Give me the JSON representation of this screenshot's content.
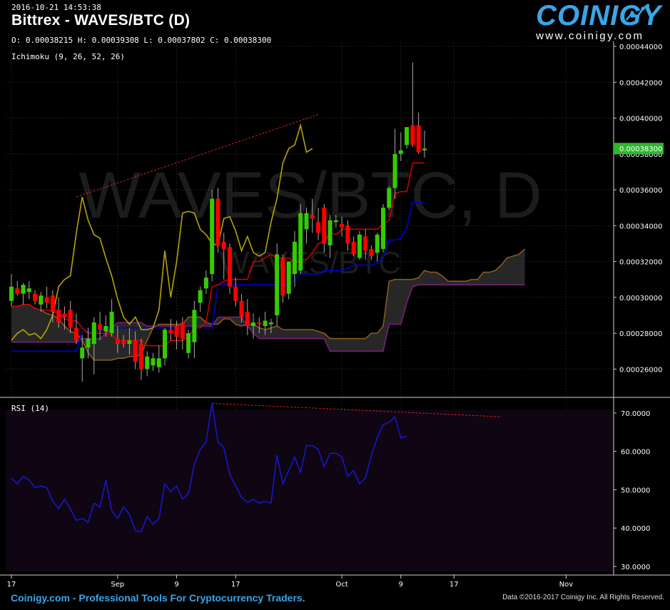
{
  "header": {
    "timestamp": "2016-10-21 14:53:38",
    "pair_title": "Bittrex - WAVES/BTC (D)",
    "ohlc": "O: 0.00038215 H: 0.00039308 L: 0.00037802 C: 0.00038300",
    "indicator": "Ichimoku (9, 26, 52, 26)"
  },
  "watermark": {
    "main": "WAVES/BTC, D",
    "sub": "WAVES/BTC"
  },
  "logo": {
    "name": "COINIGY",
    "url": "www.coinigy.com"
  },
  "rsi": {
    "label": "RSI (14)",
    "ticks": [
      "70.0000",
      "60.0000",
      "50.0000",
      "40.0000",
      "30.0000"
    ]
  },
  "footer": {
    "left": "Coinigy.com - Professional Tools For Cryptocurrency Traders.",
    "right": "Data ©2016-2017 Coinigy Inc. All Rights Reserved."
  },
  "colors": {
    "up": "#33cc00",
    "down": "#ff0000",
    "tenkan": "#cc0000",
    "kijun": "#0000cc",
    "chikou": "#b5a500",
    "spanA": "#8a5a1c",
    "spanB": "#7a1e7a",
    "rsi": "#1818c8",
    "price_tag": "#2db82d"
  },
  "chart_data": [
    {
      "type": "candlestick",
      "title": "Bittrex - WAVES/BTC (D)",
      "y_ticks": [
        "0.00044000",
        "0.00042000",
        "0.00040000",
        "0.00038000",
        "0.00036000",
        "0.00034000",
        "0.00032000",
        "0.00030000",
        "0.00028000",
        "0.00026000"
      ],
      "ylim": [
        0.000245,
        0.000442
      ],
      "x_ticks": [
        "17",
        "Sep",
        "9",
        "17",
        "Oct",
        "9",
        "17",
        "Nov"
      ],
      "last_price_label": "0.00038300",
      "candles": [
        {
          "o": 0.000298,
          "h": 0.000313,
          "l": 0.000295,
          "c": 0.000306
        },
        {
          "o": 0.000305,
          "h": 0.000309,
          "l": 0.000301,
          "c": 0.000302
        },
        {
          "o": 0.000302,
          "h": 0.000308,
          "l": 0.000296,
          "c": 0.000307
        },
        {
          "o": 0.000303,
          "h": 0.000309,
          "l": 0.000299,
          "c": 0.000305
        },
        {
          "o": 0.000302,
          "h": 0.000304,
          "l": 0.000296,
          "c": 0.000298
        },
        {
          "o": 0.000296,
          "h": 0.000303,
          "l": 0.000292,
          "c": 0.000301
        },
        {
          "o": 0.0003,
          "h": 0.000306,
          "l": 0.000294,
          "c": 0.000297
        },
        {
          "o": 0.000301,
          "h": 0.000304,
          "l": 0.000286,
          "c": 0.000292
        },
        {
          "o": 0.000293,
          "h": 0.0003,
          "l": 0.000283,
          "c": 0.000286
        },
        {
          "o": 0.000291,
          "h": 0.000295,
          "l": 0.000282,
          "c": 0.000289
        },
        {
          "o": 0.000293,
          "h": 0.000298,
          "l": 0.00028,
          "c": 0.000283
        },
        {
          "o": 0.000283,
          "h": 0.000291,
          "l": 0.000274,
          "c": 0.000276
        },
        {
          "o": 0.000266,
          "h": 0.000279,
          "l": 0.000253,
          "c": 0.000272
        },
        {
          "o": 0.000272,
          "h": 0.000283,
          "l": 0.000266,
          "c": 0.000277
        },
        {
          "o": 0.000274,
          "h": 0.000289,
          "l": 0.000257,
          "c": 0.000286
        },
        {
          "o": 0.000285,
          "h": 0.000292,
          "l": 0.000276,
          "c": 0.000282
        },
        {
          "o": 0.000281,
          "h": 0.00029,
          "l": 0.000278,
          "c": 0.000284
        },
        {
          "o": 0.00028,
          "h": 0.000299,
          "l": 0.000278,
          "c": 0.000292
        },
        {
          "o": 0.000277,
          "h": 0.000284,
          "l": 0.000269,
          "c": 0.000274
        },
        {
          "o": 0.000276,
          "h": 0.000279,
          "l": 0.000272,
          "c": 0.000274
        },
        {
          "o": 0.000274,
          "h": 0.000283,
          "l": 0.000268,
          "c": 0.000276
        },
        {
          "o": 0.000276,
          "h": 0.000281,
          "l": 0.00026,
          "c": 0.000264
        },
        {
          "o": 0.000274,
          "h": 0.000277,
          "l": 0.000254,
          "c": 0.00026
        },
        {
          "o": 0.00026,
          "h": 0.00027,
          "l": 0.000256,
          "c": 0.000267
        },
        {
          "o": 0.000262,
          "h": 0.000269,
          "l": 0.000259,
          "c": 0.000266
        },
        {
          "o": 0.000261,
          "h": 0.000273,
          "l": 0.000258,
          "c": 0.000266
        },
        {
          "o": 0.000266,
          "h": 0.000283,
          "l": 0.000262,
          "c": 0.000282
        },
        {
          "o": 0.000282,
          "h": 0.000288,
          "l": 0.000276,
          "c": 0.00028
        },
        {
          "o": 0.000284,
          "h": 0.000287,
          "l": 0.000271,
          "c": 0.000278
        },
        {
          "o": 0.000286,
          "h": 0.000289,
          "l": 0.000271,
          "c": 0.000277
        },
        {
          "o": 0.000269,
          "h": 0.000282,
          "l": 0.000266,
          "c": 0.00028
        },
        {
          "o": 0.000275,
          "h": 0.000298,
          "l": 0.000266,
          "c": 0.000293
        },
        {
          "o": 0.000297,
          "h": 0.000306,
          "l": 0.000292,
          "c": 0.000304
        },
        {
          "o": 0.000305,
          "h": 0.000315,
          "l": 0.000302,
          "c": 0.000311
        },
        {
          "o": 0.000313,
          "h": 0.00036,
          "l": 0.000309,
          "c": 0.000355
        },
        {
          "o": 0.000355,
          "h": 0.000361,
          "l": 0.000325,
          "c": 0.000329
        },
        {
          "o": 0.000331,
          "h": 0.000336,
          "l": 0.00031,
          "c": 0.000327
        },
        {
          "o": 0.000328,
          "h": 0.00033,
          "l": 0.000302,
          "c": 0.000306
        },
        {
          "o": 0.000306,
          "h": 0.000311,
          "l": 0.000295,
          "c": 0.000298
        },
        {
          "o": 0.000298,
          "h": 0.000302,
          "l": 0.000286,
          "c": 0.000289
        },
        {
          "o": 0.000292,
          "h": 0.000299,
          "l": 0.000279,
          "c": 0.000284
        },
        {
          "o": 0.000284,
          "h": 0.000291,
          "l": 0.000277,
          "c": 0.000286
        },
        {
          "o": 0.000286,
          "h": 0.000289,
          "l": 0.00028,
          "c": 0.000285
        },
        {
          "o": 0.000284,
          "h": 0.000292,
          "l": 0.000279,
          "c": 0.000287
        },
        {
          "o": 0.000285,
          "h": 0.000288,
          "l": 0.00028,
          "c": 0.000286
        },
        {
          "o": 0.00029,
          "h": 0.00033,
          "l": 0.000284,
          "c": 0.000324
        },
        {
          "o": 0.000322,
          "h": 0.000324,
          "l": 0.000297,
          "c": 0.000301
        },
        {
          "o": 0.000302,
          "h": 0.000318,
          "l": 0.000299,
          "c": 0.00032
        },
        {
          "o": 0.000313,
          "h": 0.000337,
          "l": 0.000306,
          "c": 0.000331
        },
        {
          "o": 0.000315,
          "h": 0.000352,
          "l": 0.000313,
          "c": 0.000347
        },
        {
          "o": 0.000338,
          "h": 0.00035,
          "l": 0.00033,
          "c": 0.000347
        },
        {
          "o": 0.000346,
          "h": 0.000355,
          "l": 0.000336,
          "c": 0.000344
        },
        {
          "o": 0.000342,
          "h": 0.00035,
          "l": 0.000332,
          "c": 0.000336
        },
        {
          "o": 0.00035,
          "h": 0.000352,
          "l": 0.000325,
          "c": 0.00033
        },
        {
          "o": 0.000329,
          "h": 0.000346,
          "l": 0.000322,
          "c": 0.000343
        },
        {
          "o": 0.000342,
          "h": 0.000346,
          "l": 0.000339,
          "c": 0.000343
        },
        {
          "o": 0.000341,
          "h": 0.000345,
          "l": 0.000334,
          "c": 0.000339
        },
        {
          "o": 0.00034,
          "h": 0.000343,
          "l": 0.000326,
          "c": 0.00033
        },
        {
          "o": 0.000331,
          "h": 0.000334,
          "l": 0.000323,
          "c": 0.000324
        },
        {
          "o": 0.000322,
          "h": 0.000337,
          "l": 0.000321,
          "c": 0.000335
        },
        {
          "o": 0.000334,
          "h": 0.000338,
          "l": 0.000321,
          "c": 0.000326
        },
        {
          "o": 0.000327,
          "h": 0.000329,
          "l": 0.000321,
          "c": 0.000323
        },
        {
          "o": 0.000325,
          "h": 0.000336,
          "l": 0.00032,
          "c": 0.000335
        },
        {
          "o": 0.000327,
          "h": 0.000352,
          "l": 0.000325,
          "c": 0.00035
        },
        {
          "o": 0.00035,
          "h": 0.000362,
          "l": 0.000349,
          "c": 0.000361
        },
        {
          "o": 0.000361,
          "h": 0.000394,
          "l": 0.000355,
          "c": 0.00038
        },
        {
          "o": 0.00038,
          "h": 0.000392,
          "l": 0.000376,
          "c": 0.000382
        },
        {
          "o": 0.000385,
          "h": 0.000395,
          "l": 0.000383,
          "c": 0.000395
        },
        {
          "o": 0.000396,
          "h": 0.000431,
          "l": 0.000384,
          "c": 0.000385
        },
        {
          "o": 0.000396,
          "h": 0.000403,
          "l": 0.00038,
          "c": 0.000381
        },
        {
          "o": 0.000382,
          "h": 0.000393,
          "l": 0.000378,
          "c": 0.000383
        }
      ],
      "tenkan": [
        0.000295,
        0.000295,
        0.000296,
        0.000296,
        0.000294,
        0.000293,
        0.000293,
        0.000292,
        0.000291,
        0.000288,
        0.000287,
        0.000287,
        0.000283,
        0.00028,
        0.00028,
        0.00028,
        0.00028,
        0.000279,
        0.000276,
        0.000276,
        0.000276,
        0.000276,
        0.000276,
        0.000273,
        0.000273,
        0.000273,
        0.000273,
        0.000276,
        0.000276,
        0.000276,
        0.000278,
        0.000283,
        0.000283,
        0.000286,
        0.000306,
        0.000307,
        0.000309,
        0.00031,
        0.00031,
        0.00031,
        0.00031,
        0.00032,
        0.00032,
        0.000322,
        0.000324,
        0.000322,
        0.000322,
        0.000322,
        0.000319,
        0.000321,
        0.000321,
        0.000325,
        0.00033,
        0.000331,
        0.000336,
        0.000335,
        0.000338,
        0.000338,
        0.000338,
        0.000338,
        0.000338,
        0.000338,
        0.000338,
        0.000341,
        0.000343,
        0.000358,
        0.000359,
        0.000359,
        0.000375,
        0.000375,
        0.000375
      ],
      "kijun": [
        0.00027,
        0.00027,
        0.00027,
        0.00027,
        0.00027,
        0.00027,
        0.00027,
        0.00027,
        0.00027,
        0.00027,
        0.00027,
        0.00027,
        0.000281,
        0.000281,
        0.000281,
        0.000281,
        0.000283,
        0.000283,
        0.000283,
        0.000283,
        0.000283,
        0.000283,
        0.000283,
        0.000283,
        0.000283,
        0.000283,
        0.000283,
        0.000283,
        0.000283,
        0.000283,
        0.000283,
        0.000283,
        0.000283,
        0.000283,
        0.000283,
        0.000307,
        0.000307,
        0.000307,
        0.000307,
        0.000307,
        0.000307,
        0.000307,
        0.000307,
        0.000307,
        0.000307,
        0.000307,
        0.000307,
        0.000307,
        0.00031,
        0.000313,
        0.000313,
        0.000313,
        0.000313,
        0.000315,
        0.000315,
        0.000315,
        0.000315,
        0.000316,
        0.000318,
        0.000318,
        0.000318,
        0.000318,
        0.000319,
        0.000322,
        0.000332,
        0.000332,
        0.000333,
        0.000339,
        0.000353,
        0.000353,
        0.000353
      ],
      "chikou": [
        0.000276,
        0.00028,
        0.000282,
        0.000279,
        0.00028,
        0.000277,
        0.000282,
        0.00029,
        0.000306,
        0.00031,
        0.000312,
        0.000336,
        0.000356,
        0.000343,
        0.000335,
        0.000333,
        0.000322,
        0.000312,
        0.000299,
        0.000289,
        0.000285,
        0.000289,
        0.000282,
        0.000282,
        0.000283,
        0.000293,
        0.000326,
        0.0003,
        0.00032,
        0.000347,
        0.000348,
        0.000347,
        0.000338,
        0.000335,
        0.00033,
        0.000329,
        0.000344,
        0.000345,
        0.000337,
        0.000326,
        0.000334,
        0.000325,
        0.000323,
        0.000325,
        0.000342,
        0.000355,
        0.000375,
        0.000383,
        0.000385,
        0.000396,
        0.000381,
        0.000383
      ],
      "senkou_a": [
        0.000295,
        0.000295,
        0.000296,
        0.000296,
        0.000294,
        0.000293,
        0.000291,
        0.00029,
        0.000288,
        0.000284,
        0.000281,
        0.00028,
        0.000276,
        0.000269,
        0.000265,
        0.000265,
        0.000265,
        0.000265,
        0.000266,
        0.000266,
        0.000267,
        0.000267,
        0.000268,
        0.000276,
        0.000283,
        0.000285,
        0.000285,
        0.000285,
        0.000285,
        0.000285,
        0.000289,
        0.000289,
        0.000289,
        0.000286,
        0.000285,
        0.000285,
        0.000288,
        0.000288,
        0.000285,
        0.000284,
        0.000285,
        0.000285,
        0.000283,
        0.000282,
        0.000283,
        0.000284,
        0.000282,
        0.000282,
        0.000282,
        0.000282,
        0.000282,
        0.000282,
        0.000281,
        0.00028,
        0.000277,
        0.000277,
        0.000277,
        0.000277,
        0.000277,
        0.000277,
        0.000277,
        0.00028,
        0.00028,
        0.000284,
        0.000309,
        0.00031,
        0.00031,
        0.00031,
        0.00031,
        0.000311,
        0.000315,
        0.000314,
        0.000314,
        0.000312,
        0.000309,
        0.000309,
        0.000309,
        0.000309,
        0.00031,
        0.00031,
        0.000314,
        0.000314,
        0.000315,
        0.000318,
        0.000322,
        0.000323,
        0.000324,
        0.000327
      ],
      "senkou_b": [
        0.000275,
        0.000275,
        0.000275,
        0.000275,
        0.000275,
        0.000275,
        0.000275,
        0.000275,
        0.000275,
        0.000275,
        0.000275,
        0.000275,
        0.000277,
        0.000277,
        0.000277,
        0.000277,
        0.00028,
        0.000283,
        0.000286,
        0.000286,
        0.000286,
        0.000286,
        0.000286,
        0.000284,
        0.000284,
        0.000284,
        0.000284,
        0.000284,
        0.000284,
        0.000284,
        0.000284,
        0.000284,
        0.000284,
        0.000284,
        0.000284,
        0.000289,
        0.000289,
        0.000289,
        0.000289,
        0.000289,
        0.000284,
        0.00028,
        0.000277,
        0.000277,
        0.000277,
        0.000277,
        0.000277,
        0.000277,
        0.000277,
        0.000277,
        0.000277,
        0.000277,
        0.000277,
        0.000277,
        0.00027,
        0.00027,
        0.00027,
        0.00027,
        0.00027,
        0.00027,
        0.00027,
        0.00027,
        0.00027,
        0.00027,
        0.000285,
        0.000285,
        0.000285,
        0.000297,
        0.000306,
        0.000307,
        0.000307,
        0.000307,
        0.000307,
        0.000307,
        0.000307,
        0.000307,
        0.000307,
        0.000307,
        0.000307,
        0.000307,
        0.000307,
        0.000307,
        0.000307,
        0.000307,
        0.000307,
        0.000307,
        0.000307,
        0.000307
      ],
      "annotations": [
        "Trend line on Chikou span highs (dashed red)"
      ]
    },
    {
      "type": "line",
      "title": "RSI (14)",
      "ylim": [
        28.5,
        73.5
      ],
      "y_ticks": [
        "70.0000",
        "60.0000",
        "50.0000",
        "40.0000",
        "30.0000"
      ],
      "reference_lines": [
        70,
        30
      ],
      "values": [
        53,
        51.5,
        53.5,
        52.5,
        50.5,
        51,
        50.5,
        47,
        45,
        47.5,
        45,
        42,
        42.5,
        41.5,
        46.5,
        45.5,
        52.5,
        44.5,
        42.5,
        45.5,
        43.5,
        39.3,
        39,
        43,
        41,
        42.5,
        51.5,
        49.5,
        51,
        47.5,
        49,
        56.5,
        60.5,
        62.5,
        72.5,
        62.5,
        61,
        54,
        51,
        48,
        46.7,
        47.5,
        46.5,
        47,
        46.5,
        59,
        51.5,
        55,
        58.5,
        54.5,
        61.5,
        61.5,
        60.5,
        56,
        59.5,
        59.5,
        58.5,
        53.5,
        55,
        51.5,
        53,
        59,
        63.5,
        67,
        67.5,
        69,
        63.5,
        64
      ]
    }
  ]
}
